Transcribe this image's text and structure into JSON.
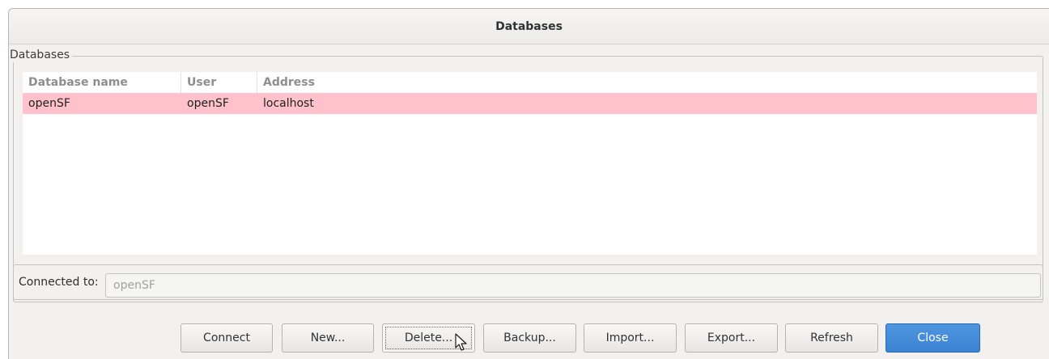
{
  "window": {
    "title": "Databases"
  },
  "group": {
    "label": "Databases"
  },
  "table": {
    "columns": [
      "Database name",
      "User",
      "Address"
    ],
    "rows": [
      {
        "name": "openSF",
        "user": "openSF",
        "address": "localhost",
        "selected": true
      }
    ]
  },
  "connection": {
    "label": "Connected to:",
    "value": "openSF"
  },
  "buttons": {
    "connect": "Connect",
    "new": "New...",
    "delete": "Delete...",
    "backup": "Backup...",
    "import": "Import...",
    "export": "Export...",
    "refresh": "Refresh",
    "close": "Close"
  },
  "colors": {
    "selected_row": "#ffc1cc",
    "primary_button": "#3b83d3"
  }
}
